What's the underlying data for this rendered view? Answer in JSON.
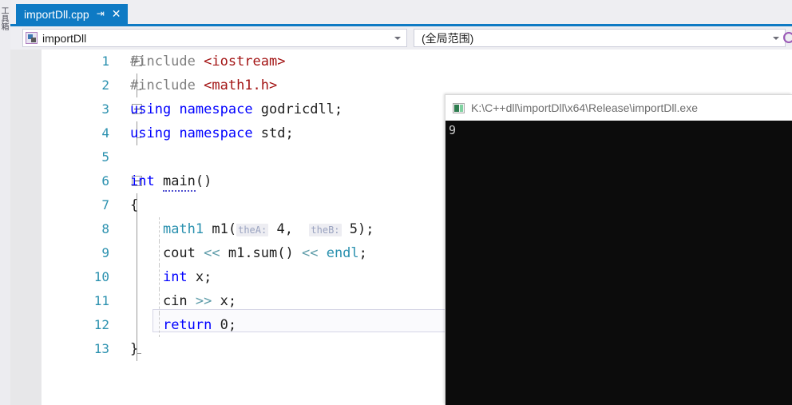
{
  "toolbox": {
    "label": "工具箱",
    "chars": [
      "工",
      "具",
      "箱"
    ]
  },
  "tab": {
    "title": "importDll.cpp",
    "pin_icon": "⇥",
    "close_icon": "✕",
    "active_color": "#0E7AC4"
  },
  "navbar": {
    "left_value": "importDll",
    "right_value": "(全局范围)",
    "caret_icon": "▾",
    "project_icon": "project-icon",
    "right_edge_icon": "globe-icon"
  },
  "editor": {
    "lines": [
      {
        "num": "1",
        "fold": "open",
        "tokens": [
          {
            "t": "#include ",
            "c": "pp"
          },
          {
            "t": "<iostream>",
            "c": "str-inc"
          }
        ]
      },
      {
        "num": "2",
        "fold": "bar-end",
        "tokens": [
          {
            "t": "#include ",
            "c": "pp"
          },
          {
            "t": "<math1.h>",
            "c": "str-inc"
          }
        ]
      },
      {
        "num": "3",
        "fold": "open",
        "tokens": [
          {
            "t": "using",
            "c": "kw"
          },
          {
            "t": " ",
            "c": "plain"
          },
          {
            "t": "namespace",
            "c": "kw"
          },
          {
            "t": " godricdll;",
            "c": "plain"
          }
        ]
      },
      {
        "num": "4",
        "fold": "bar-end",
        "tokens": [
          {
            "t": "using",
            "c": "kw"
          },
          {
            "t": " ",
            "c": "plain"
          },
          {
            "t": "namespace",
            "c": "kw"
          },
          {
            "t": " std;",
            "c": "plain"
          }
        ]
      },
      {
        "num": "5",
        "fold": "none",
        "tokens": []
      },
      {
        "num": "6",
        "fold": "open",
        "tokens": [
          {
            "t": "int",
            "c": "kw"
          },
          {
            "t": " ",
            "c": "plain"
          },
          {
            "t": "main",
            "c": "plain squiggle"
          },
          {
            "t": "()",
            "c": "plain"
          }
        ]
      },
      {
        "num": "7",
        "fold": "bar",
        "tokens": [
          {
            "t": "{",
            "c": "plain"
          }
        ]
      },
      {
        "num": "8",
        "fold": "bar",
        "indent": true,
        "tokens": [
          {
            "t": "    ",
            "c": "plain"
          },
          {
            "t": "math1",
            "c": "type"
          },
          {
            "t": " m1(",
            "c": "plain"
          },
          {
            "t": "theA:",
            "c": "hint"
          },
          {
            "t": " 4,  ",
            "c": "plain"
          },
          {
            "t": "theB:",
            "c": "hint"
          },
          {
            "t": " 5);",
            "c": "plain"
          }
        ]
      },
      {
        "num": "9",
        "fold": "bar",
        "indent": true,
        "tokens": [
          {
            "t": "    cout ",
            "c": "plain"
          },
          {
            "t": "<<",
            "c": "op"
          },
          {
            "t": " m1.sum() ",
            "c": "plain"
          },
          {
            "t": "<<",
            "c": "op"
          },
          {
            "t": " ",
            "c": "plain"
          },
          {
            "t": "endl",
            "c": "type"
          },
          {
            "t": ";",
            "c": "plain"
          }
        ]
      },
      {
        "num": "10",
        "fold": "bar",
        "indent": true,
        "current": true,
        "tokens": [
          {
            "t": "    ",
            "c": "plain"
          },
          {
            "t": "int",
            "c": "kw"
          },
          {
            "t": " x;",
            "c": "plain"
          }
        ]
      },
      {
        "num": "11",
        "fold": "bar",
        "indent": true,
        "tokens": [
          {
            "t": "    cin ",
            "c": "plain"
          },
          {
            "t": ">>",
            "c": "op"
          },
          {
            "t": " x;",
            "c": "plain"
          }
        ]
      },
      {
        "num": "12",
        "fold": "bar",
        "indent": true,
        "tokens": [
          {
            "t": "    ",
            "c": "plain"
          },
          {
            "t": "return",
            "c": "kw"
          },
          {
            "t": " 0;",
            "c": "plain"
          }
        ]
      },
      {
        "num": "13",
        "fold": "bar-end",
        "tokens": [
          {
            "t": "}",
            "c": "plain"
          }
        ]
      }
    ]
  },
  "console": {
    "title": "K:\\C++dll\\importDll\\x64\\Release\\importDll.exe",
    "icon": "console-app-icon",
    "output": "9"
  }
}
